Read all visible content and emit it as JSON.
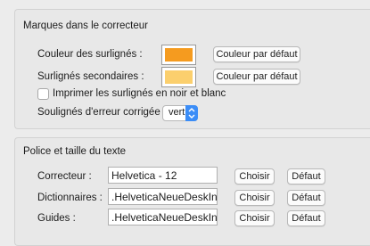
{
  "checker": {
    "title": "Marques dans le correcteur",
    "highlight_color_label": "Couleur des surlignés :",
    "highlight_color": "#f59b1f",
    "highlight_default_button": "Couleur par défaut",
    "secondary_label": "Surlignés secondaires :",
    "secondary_color": "#fbcf6d",
    "secondary_default_button": "Couleur par défaut",
    "print_bw_label": "Imprimer les surlignés en noir et blanc",
    "print_bw_checked": false,
    "corrected_error_label": "Soulignés d'erreur corrigée :",
    "corrected_error_value": "vert"
  },
  "fonts": {
    "title": "Police et taille du texte",
    "rows": [
      {
        "label": "Correcteur :",
        "value": "Helvetica - 12",
        "choose": "Choisir",
        "default": "Défaut"
      },
      {
        "label": "Dictionnaires :",
        "value": ".HelveticaNeueDeskInterf",
        "choose": "Choisir",
        "default": "Défaut"
      },
      {
        "label": "Guides :",
        "value": ".HelveticaNeueDeskInterf",
        "choose": "Choisir",
        "default": "Défaut"
      }
    ]
  }
}
